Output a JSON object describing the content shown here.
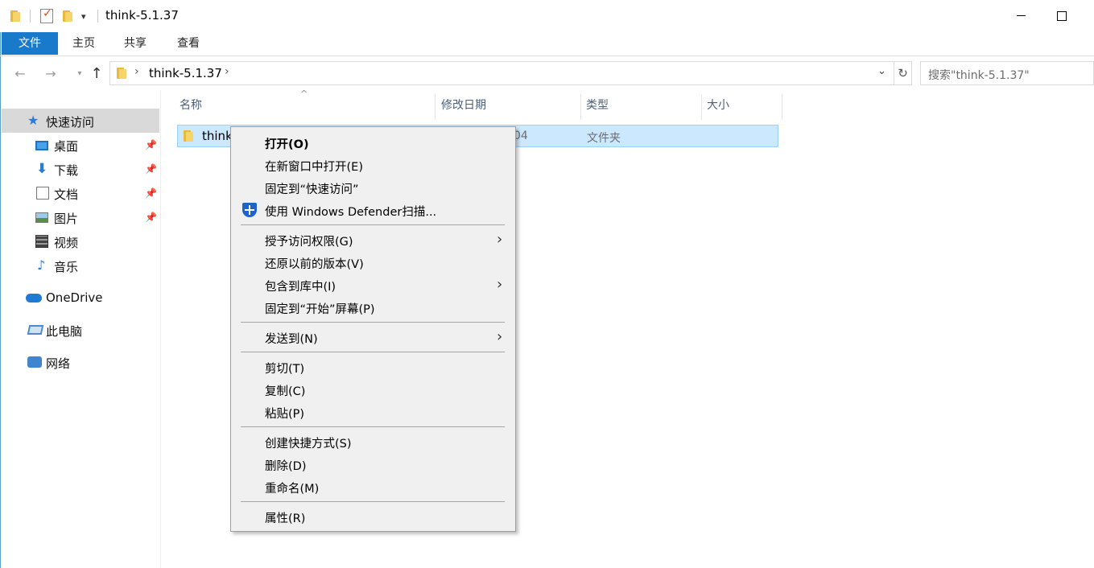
{
  "window": {
    "title": "think-5.1.37"
  },
  "ribbon": {
    "tabs": [
      "文件",
      "主页",
      "共享",
      "查看"
    ]
  },
  "address": {
    "path": "think-5.1.37",
    "search_placeholder": "搜索\"think-5.1.37\""
  },
  "nav": {
    "quick_access": "快速访问",
    "items": [
      "桌面",
      "下载",
      "文档",
      "图片",
      "视频",
      "音乐"
    ],
    "onedrive": "OneDrive",
    "this_pc": "此电脑",
    "network": "网络"
  },
  "columns": {
    "name": "名称",
    "date": "修改日期",
    "type": "类型",
    "size": "大小"
  },
  "file": {
    "name": "think",
    "date_fragment": "04",
    "type": "文件夹"
  },
  "context_menu": {
    "open": "打开(O)",
    "open_new_window": "在新窗口中打开(E)",
    "pin_quick_access": "固定到“快速访问”",
    "defender_scan": "使用 Windows Defender扫描...",
    "grant_access": "授予访问权限(G)",
    "restore_versions": "还原以前的版本(V)",
    "include_library": "包含到库中(I)",
    "pin_start": "固定到“开始”屏幕(P)",
    "send_to": "发送到(N)",
    "cut": "剪切(T)",
    "copy": "复制(C)",
    "paste": "粘贴(P)",
    "create_shortcut": "创建快捷方式(S)",
    "delete": "删除(D)",
    "rename": "重命名(M)",
    "properties": "属性(R)"
  },
  "colors": {
    "file_tab": "#1979ca",
    "selection": "#cce8ff",
    "menu_bg": "#f0f0f0"
  }
}
